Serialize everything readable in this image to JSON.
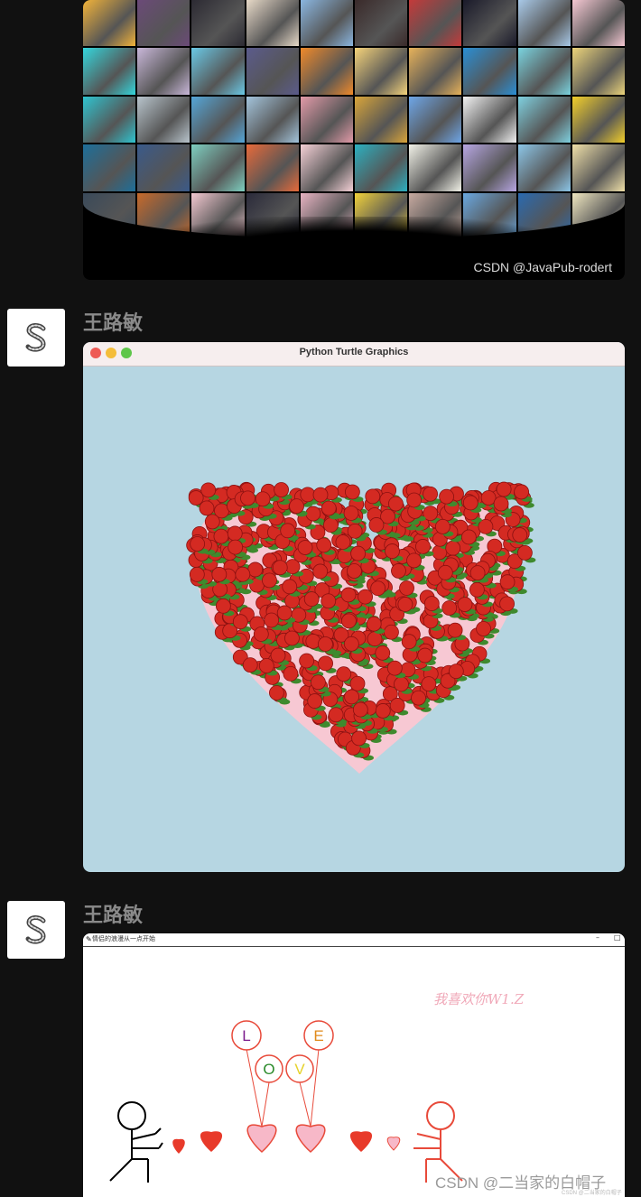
{
  "messages": [
    {
      "image": {
        "type": "photo-wall",
        "watermark": "CSDN @JavaPub-rodert",
        "tile_colors": [
          "#f2b33a",
          "#6b4a78",
          "#2c2a33",
          "#e7d9c7",
          "#8ab6e0",
          "#3a2a2a",
          "#c43a3a",
          "#1a1a2a",
          "#a8c9e8",
          "#f5c7d2",
          "#34d6dc",
          "#c9b7d9",
          "#6ac9e6",
          "#5b5b8c",
          "#f08a2a",
          "#f5d37a",
          "#e7b25a",
          "#2a8fd4",
          "#7ad3df",
          "#ecd47a",
          "#2fc4d0",
          "#b8c4cc",
          "#55a6d8",
          "#a3c4dc",
          "#e29aa8",
          "#d9a53a",
          "#6ea6e8",
          "#f2f2f2",
          "#7fd0df",
          "#f3cf2a",
          "#1d6f9a",
          "#3a5a8a",
          "#7ecfc0",
          "#e86a3a",
          "#f5d0d6",
          "#2cb0c0",
          "#f2f2e8",
          "#b7a6e3",
          "#8cc6e8",
          "#f0e0a8",
          "#3a4a5a",
          "#c86a2a",
          "#f3c8d0",
          "#2a2a3a",
          "#e7b3c2",
          "#f2d23a",
          "#c8aaa0",
          "#6aa8e0",
          "#2a6ab0",
          "#f0e7c0"
        ]
      }
    },
    {
      "sender": "王路敏",
      "avatar_letter": "S",
      "image": {
        "type": "turtle-window",
        "window_title": "Python Turtle Graphics",
        "canvas_color": "#b6d6e2",
        "heart_color": "#f7c8d3",
        "rose_color": "#d42a22"
      }
    },
    {
      "sender": "王路敏",
      "avatar_letter": "S",
      "image": {
        "type": "love-window",
        "window_title": "情侣的浪漫从一点开始",
        "window_controls": [
          "–",
          "□"
        ],
        "greeting": "我喜欢你W1.Z",
        "balloon_letters": [
          {
            "letter": "L",
            "color": "#7b1a8c"
          },
          {
            "letter": "O",
            "color": "#2a8a2a"
          },
          {
            "letter": "V",
            "color": "#e6d22a"
          },
          {
            "letter": "E",
            "color": "#e08a1a"
          }
        ],
        "watermark": "CSDN @二当家的白帽子",
        "small_watermark": "CSDN @二当家的白帽子"
      }
    }
  ]
}
